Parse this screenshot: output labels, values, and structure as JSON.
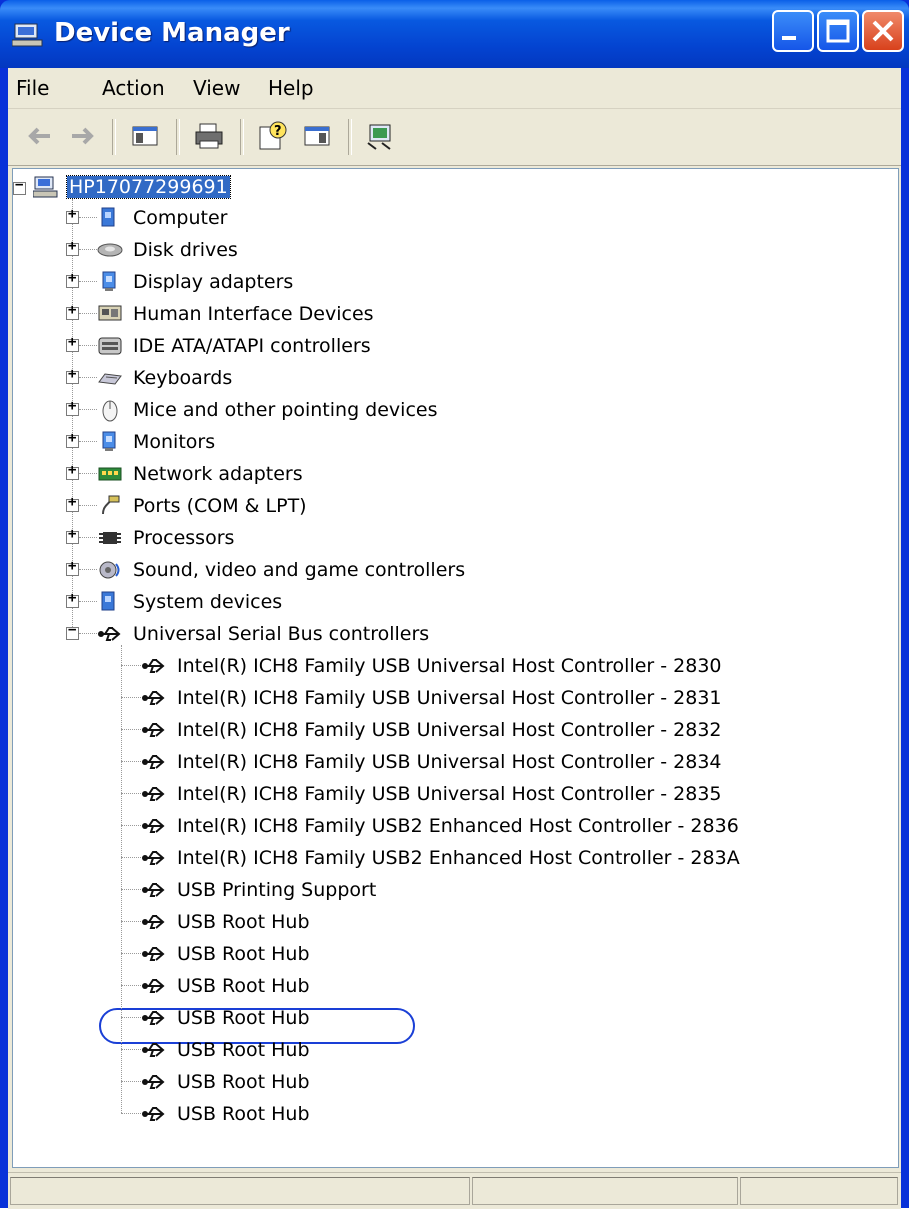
{
  "window": {
    "title": "Device Manager"
  },
  "menu": [
    "File",
    "Action",
    "View",
    "Help"
  ],
  "tree": {
    "root": "HP17077299691",
    "categories": [
      {
        "label": "Computer",
        "icon": "computer-icon"
      },
      {
        "label": "Disk drives",
        "icon": "disk-drive-icon"
      },
      {
        "label": "Display adapters",
        "icon": "display-adapter-icon"
      },
      {
        "label": "Human Interface Devices",
        "icon": "hid-icon"
      },
      {
        "label": "IDE ATA/ATAPI controllers",
        "icon": "ide-controller-icon"
      },
      {
        "label": "Keyboards",
        "icon": "keyboard-icon"
      },
      {
        "label": "Mice and other pointing devices",
        "icon": "mouse-icon"
      },
      {
        "label": "Monitors",
        "icon": "monitor-icon"
      },
      {
        "label": "Network adapters",
        "icon": "network-adapter-icon"
      },
      {
        "label": "Ports (COM & LPT)",
        "icon": "port-icon"
      },
      {
        "label": "Processors",
        "icon": "processor-icon"
      },
      {
        "label": "Sound, video and game controllers",
        "icon": "sound-icon"
      },
      {
        "label": "System devices",
        "icon": "system-device-icon"
      },
      {
        "label": "Universal Serial Bus controllers",
        "icon": "usb-icon"
      }
    ],
    "usb_children": [
      "Intel(R) ICH8 Family USB Universal Host Controller - 2830",
      "Intel(R) ICH8 Family USB Universal Host Controller - 2831",
      "Intel(R) ICH8 Family USB Universal Host Controller - 2832",
      "Intel(R) ICH8 Family USB Universal Host Controller - 2834",
      "Intel(R) ICH8 Family USB Universal Host Controller - 2835",
      "Intel(R) ICH8 Family USB2 Enhanced Host Controller - 2836",
      "Intel(R) ICH8 Family USB2 Enhanced Host Controller - 283A",
      "USB Printing Support",
      "USB Root Hub",
      "USB Root Hub",
      "USB Root Hub",
      "USB Root Hub",
      "USB Root Hub",
      "USB Root Hub",
      "USB Root Hub"
    ],
    "highlighted_child": "USB Printing Support"
  },
  "colors": {
    "titlebar": "#0553dd",
    "selection": "#316ac5",
    "highlight_ring": "#1a3fd6",
    "chrome": "#ece9d8"
  }
}
